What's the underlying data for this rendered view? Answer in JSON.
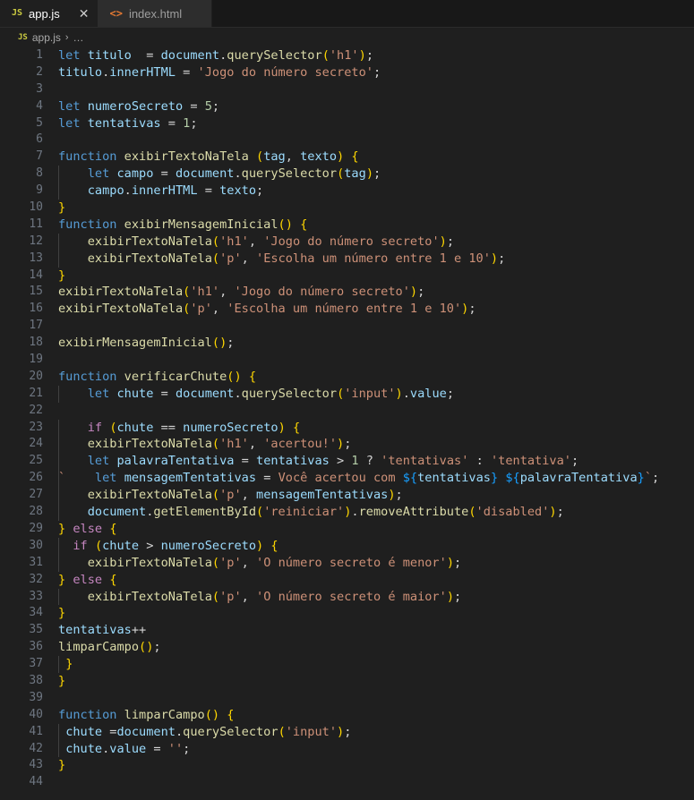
{
  "window": {
    "background": "#1f1f1f",
    "tabbar_background": "#181818"
  },
  "tabs": [
    {
      "label": "app.js",
      "icon": "js-file-icon",
      "icon_glyph": "JS",
      "active": true,
      "close_glyph": "✕"
    },
    {
      "label": "index.html",
      "icon": "html-file-icon",
      "icon_glyph": "<>",
      "active": false,
      "close_glyph": "✕"
    }
  ],
  "breadcrumb": {
    "icon_glyph": "JS",
    "file": "app.js",
    "separator": "›",
    "overflow": "…"
  },
  "editor": {
    "language": "javascript",
    "theme": "Dark Modern",
    "first_line": 1,
    "last_line": 44,
    "total_lines": 44,
    "colors": {
      "background": "#1f1f1f",
      "line_number": "#6e7681",
      "keyword": "#569cd6",
      "control_keyword": "#c586c0",
      "variable": "#9cdcfe",
      "function": "#dcdcaa",
      "string": "#ce9178",
      "number": "#b5cea8",
      "operator": "#d4d4d4",
      "bracket_level_1": "#ffd700",
      "bracket_level_2": "#da70d6",
      "bracket_level_3": "#179fff",
      "indent_guide": "#404040"
    },
    "lines": [
      {
        "n": 1,
        "text": "let titulo  = document.querySelector('h1');"
      },
      {
        "n": 2,
        "text": "titulo.innerHTML = 'Jogo do número secreto';"
      },
      {
        "n": 3,
        "text": ""
      },
      {
        "n": 4,
        "text": "let numeroSecreto = 5;"
      },
      {
        "n": 5,
        "text": "let tentativas = 1;"
      },
      {
        "n": 6,
        "text": ""
      },
      {
        "n": 7,
        "text": "function exibirTextoNaTela (tag, texto) {"
      },
      {
        "n": 8,
        "text": "    let campo = document.querySelector(tag);"
      },
      {
        "n": 9,
        "text": "    campo.innerHTML = texto;"
      },
      {
        "n": 10,
        "text": "}"
      },
      {
        "n": 11,
        "text": "function exibirMensagemInicial() {"
      },
      {
        "n": 12,
        "text": "    exibirTextoNaTela('h1', 'Jogo do número secreto');"
      },
      {
        "n": 13,
        "text": "    exibirTextoNaTela('p', 'Escolha um número entre 1 e 10');"
      },
      {
        "n": 14,
        "text": "}"
      },
      {
        "n": 15,
        "text": "exibirTextoNaTela('h1', 'Jogo do número secreto');"
      },
      {
        "n": 16,
        "text": "exibirTextoNaTela('p', 'Escolha um número entre 1 e 10');"
      },
      {
        "n": 17,
        "text": ""
      },
      {
        "n": 18,
        "text": "exibirMensagemInicial();"
      },
      {
        "n": 19,
        "text": ""
      },
      {
        "n": 20,
        "text": "function verificarChute() {"
      },
      {
        "n": 21,
        "text": "    let chute = document.querySelector('input').value;"
      },
      {
        "n": 22,
        "text": ""
      },
      {
        "n": 23,
        "text": "    if (chute == numeroSecreto) {"
      },
      {
        "n": 24,
        "text": "    exibirTextoNaTela('h1', 'acertou!');"
      },
      {
        "n": 25,
        "text": "    let palavraTentativa = tentativas > 1 ? 'tentativas' : 'tentativa';"
      },
      {
        "n": 26,
        "text": "    let mensagemTentativas = `Você acertou com ${tentativas} ${palavraTentativa}`;"
      },
      {
        "n": 27,
        "text": "    exibirTextoNaTela('p', mensagemTentativas);"
      },
      {
        "n": 28,
        "text": "    document.getElementById('reiniciar').removeAttribute('disabled');"
      },
      {
        "n": 29,
        "text": "} else {"
      },
      {
        "n": 30,
        "text": "  if (chute > numeroSecreto) {"
      },
      {
        "n": 31,
        "text": "    exibirTextoNaTela('p', 'O número secreto é menor');"
      },
      {
        "n": 32,
        "text": "} else {"
      },
      {
        "n": 33,
        "text": "    exibirTextoNaTela('p', 'O número secreto é maior');"
      },
      {
        "n": 34,
        "text": "}"
      },
      {
        "n": 35,
        "text": "tentativas++"
      },
      {
        "n": 36,
        "text": "limparCampo();"
      },
      {
        "n": 37,
        "text": " }"
      },
      {
        "n": 38,
        "text": "}"
      },
      {
        "n": 39,
        "text": ""
      },
      {
        "n": 40,
        "text": "function limparCampo() {"
      },
      {
        "n": 41,
        "text": " chute =document.querySelector('input');"
      },
      {
        "n": 42,
        "text": " chute.value = '';"
      },
      {
        "n": 43,
        "text": "}"
      },
      {
        "n": 44,
        "text": ""
      }
    ]
  }
}
